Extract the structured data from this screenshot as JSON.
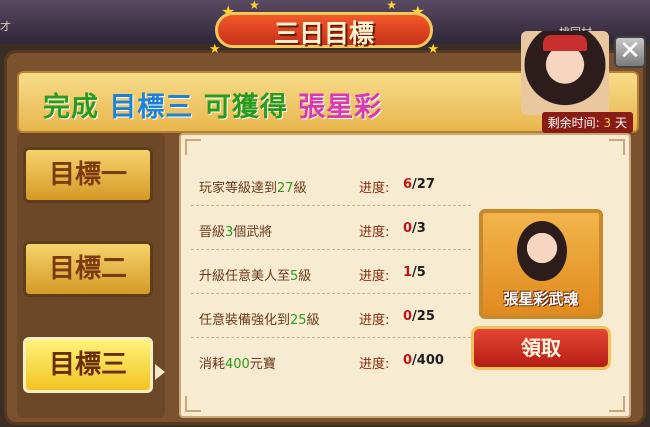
{
  "background": {
    "top_left_text": "才",
    "top_right_text": "桃园村"
  },
  "banner": {
    "title": "三日目標"
  },
  "header": {
    "headline_parts": [
      "完成",
      "目標三",
      "可獲得",
      "張星彩"
    ],
    "timer_label": "剩余时间:",
    "timer_value": "3",
    "timer_unit": "天"
  },
  "tabs": [
    {
      "label": "目標一",
      "active": false
    },
    {
      "label": "目標二",
      "active": false
    },
    {
      "label": "目標三",
      "active": true
    }
  ],
  "tasks": [
    {
      "pre": "玩家等級達到",
      "num": "27",
      "post": "級",
      "progress_label": "进度:",
      "current": "6",
      "total": "/27"
    },
    {
      "pre": "晉級",
      "num": "3",
      "post": "個武將",
      "progress_label": "进度:",
      "current": "0",
      "total": "/3"
    },
    {
      "pre": "升級任意美人至",
      "num": "5",
      "post": "級",
      "progress_label": "进度:",
      "current": "1",
      "total": "/5"
    },
    {
      "pre": "任意裝備強化到",
      "num": "25",
      "post": "級",
      "progress_label": "进度:",
      "current": "0",
      "total": "/25"
    },
    {
      "pre": "消耗",
      "num": "400",
      "post": "元寶",
      "progress_label": "进度:",
      "current": "0",
      "total": "/400"
    }
  ],
  "reward": {
    "label": "張星彩武魂"
  },
  "claim_button": {
    "label": "領取"
  },
  "icons": {
    "close": "close-icon",
    "stars": "star-icon"
  },
  "colors": {
    "ribbon": "#e0462a",
    "panel": "#f7ecd2",
    "claim": "#c9281c",
    "active_tab": "#f8d936"
  }
}
